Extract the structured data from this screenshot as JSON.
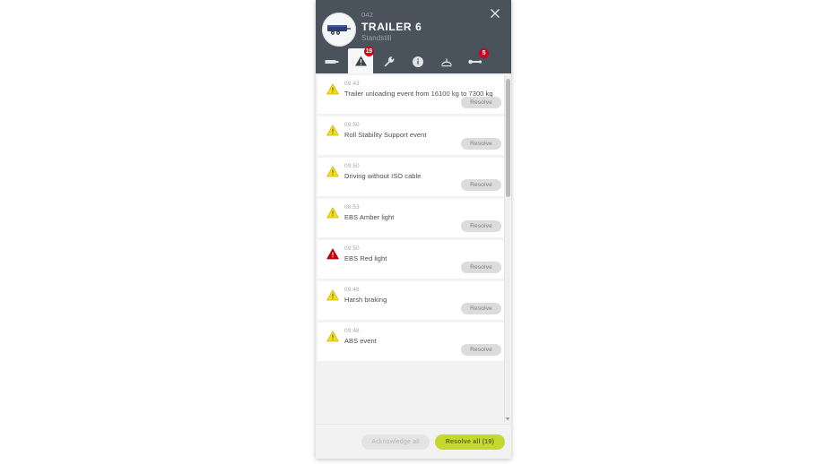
{
  "header": {
    "fleet_number": "042",
    "title": "TRAILER 6",
    "status": "Standstill",
    "close_label": "×",
    "avatar_icon": "trailer-icon"
  },
  "tabs": [
    {
      "id": "overview",
      "icon": "trailer-side-icon",
      "badge": null,
      "active": false
    },
    {
      "id": "events",
      "icon": "warning-triangle-icon",
      "badge": "19",
      "active": true
    },
    {
      "id": "service",
      "icon": "wrench-icon",
      "badge": null,
      "active": false
    },
    {
      "id": "info",
      "icon": "info-circle-icon",
      "badge": null,
      "active": false
    },
    {
      "id": "tyre",
      "icon": "tyre-pressure-icon",
      "badge": null,
      "active": false
    },
    {
      "id": "axle",
      "icon": "axle-icon",
      "badge": "5",
      "active": false
    }
  ],
  "events": [
    {
      "severity": "warning",
      "time": "09:43",
      "text": "Trailer unloading event from 16100 kg to 7300 kg",
      "action": "Resolve"
    },
    {
      "severity": "warning",
      "time": "09:50",
      "text": "Roll Stability Support event",
      "action": "Resolve"
    },
    {
      "severity": "warning",
      "time": "09:50",
      "text": "Driving without ISO cable",
      "action": "Resolve"
    },
    {
      "severity": "warning",
      "time": "08:53",
      "text": "EBS Amber light",
      "action": "Resolve"
    },
    {
      "severity": "critical",
      "time": "09:50",
      "text": "EBS Red light",
      "action": "Resolve"
    },
    {
      "severity": "warning",
      "time": "09:48",
      "text": "Harsh braking",
      "action": "Resolve"
    },
    {
      "severity": "warning",
      "time": "09:48",
      "text": "ABS event",
      "action": "Resolve"
    }
  ],
  "footer": {
    "acknowledge_label": "Acknowledge all",
    "resolve_all_label": "Resolve all (19)"
  },
  "colors": {
    "header_bg": "#4a535c",
    "accent_green": "#c4d82e",
    "badge_red": "#d0021b",
    "warning_yellow": "#f2d400",
    "critical_red": "#cc0000"
  }
}
